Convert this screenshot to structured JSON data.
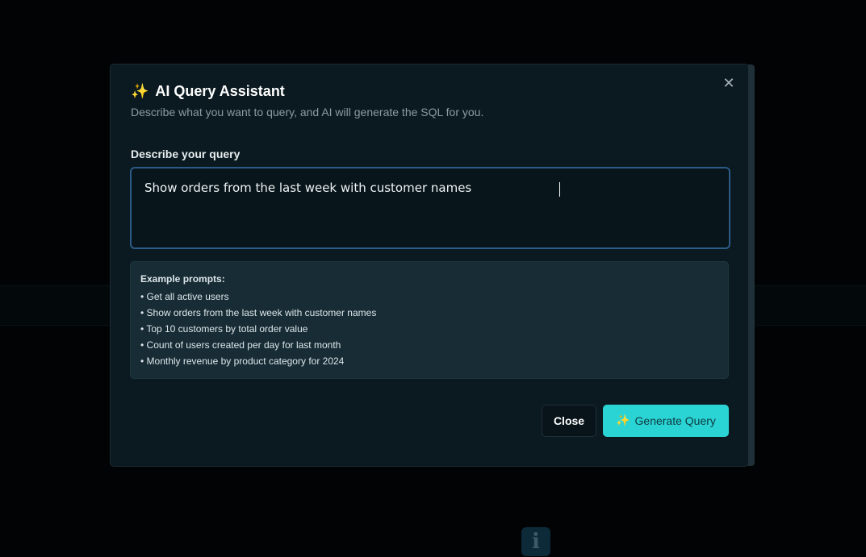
{
  "modal": {
    "title": "AI Query Assistant",
    "title_icon": "sparkles-icon",
    "subtitle": "Describe what you want to query, and AI will generate the SQL for you.",
    "close_icon": "close-icon",
    "field_label": "Describe your query",
    "query_value": "Show orders from the last week with customer names",
    "examples": {
      "title": "Example prompts:",
      "items": [
        "• Get all active users",
        "• Show orders from the last week with customer names",
        "• Top 10 customers by total order value",
        "• Count of users created per day for last month",
        "• Monthly revenue by product category for 2024"
      ]
    },
    "buttons": {
      "close_label": "Close",
      "generate_label": "Generate Query",
      "generate_icon": "sparkles-icon"
    }
  },
  "colors": {
    "accent": "#2bd4d4",
    "modal_bg": "#0b1a20",
    "input_border": "#2b5b86",
    "examples_bg": "#172c35"
  },
  "background": {
    "info_icon": "info-icon"
  }
}
